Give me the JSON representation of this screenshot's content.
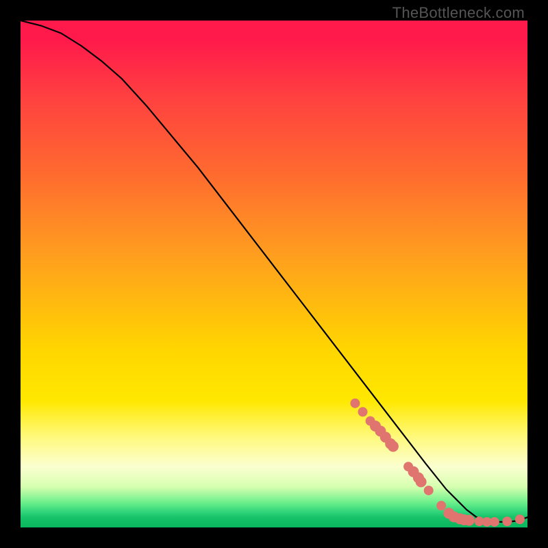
{
  "footer_label": "TheBottleneck.com",
  "colors": {
    "curve": "#000000",
    "marker_fill": "#e0746f",
    "marker_stroke": "#d65f5b"
  },
  "chart_data": {
    "type": "line",
    "title": "",
    "xlabel": "",
    "ylabel": "",
    "xlim": [
      0,
      100
    ],
    "ylim": [
      0,
      100
    ],
    "series": [
      {
        "name": "curve",
        "x": [
          0,
          4,
          8,
          12,
          16,
          20,
          25,
          30,
          35,
          40,
          45,
          50,
          55,
          60,
          65,
          70,
          75,
          80,
          82,
          84,
          86,
          88,
          90,
          92,
          94,
          96,
          98,
          100
        ],
        "y": [
          100,
          99,
          97.5,
          95,
          92,
          88.5,
          83,
          77,
          71,
          64.5,
          58,
          51.5,
          45,
          38.5,
          32,
          25.5,
          19,
          12.5,
          10,
          7.5,
          5.5,
          3.5,
          2,
          1.3,
          1.1,
          1.1,
          1.3,
          2
        ]
      }
    ],
    "markers": {
      "name": "highlighted-points",
      "x": [
        66,
        67.5,
        69,
        70,
        71,
        72,
        73,
        73.5,
        76.5,
        77.5,
        78.5,
        79,
        80.5,
        83,
        84.5,
        85.5,
        86.7,
        87.5,
        88.5,
        90.5,
        92,
        93.5,
        96,
        98.5
      ],
      "y": [
        24.5,
        22.8,
        21,
        20,
        19,
        17.8,
        16.5,
        16,
        12,
        11,
        9.8,
        9,
        7.3,
        4.3,
        2.8,
        2.1,
        1.7,
        1.5,
        1.4,
        1.2,
        1.1,
        1.1,
        1.2,
        1.6
      ],
      "size": [
        7,
        7,
        7,
        8,
        8,
        8,
        8,
        8,
        7,
        8,
        8,
        8,
        7,
        7,
        8,
        8,
        8,
        8,
        8,
        7,
        7,
        7,
        7,
        7
      ]
    }
  }
}
